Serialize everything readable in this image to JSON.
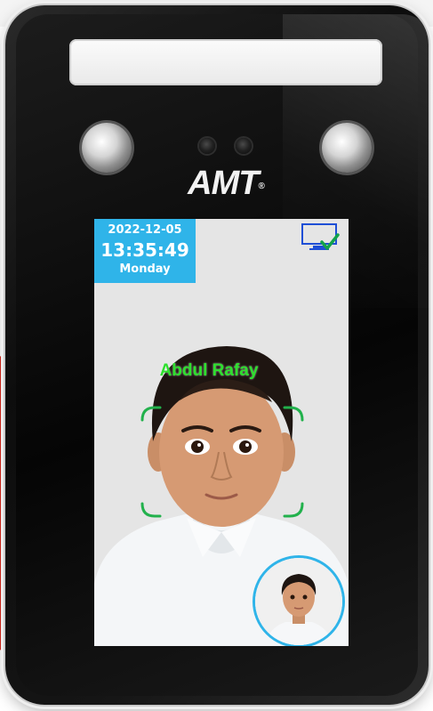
{
  "device": {
    "brand": "AMT",
    "registered_mark": "®"
  },
  "screen": {
    "date": "2022-12-05",
    "time": "13:35:49",
    "weekday": "Monday",
    "recognized_name": "Abdul Rafay",
    "status_icon": "monitor-check-icon"
  },
  "colors": {
    "date_box": "#2fb4e9",
    "name_text": "#2ee02e",
    "face_frame": "#22b14c",
    "brand_red": "#d9281c"
  }
}
